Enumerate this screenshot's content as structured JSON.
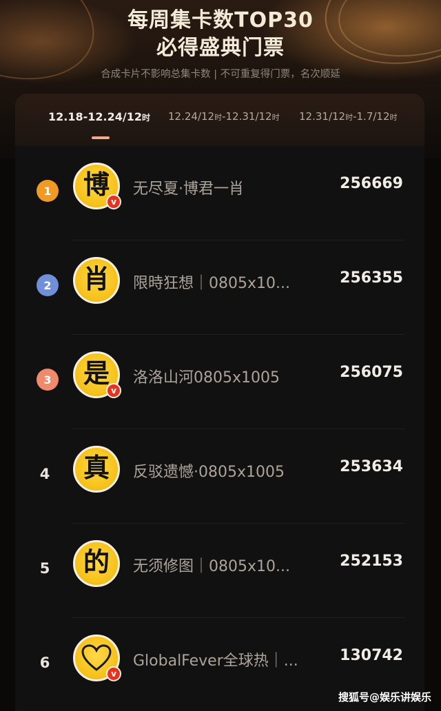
{
  "header": {
    "title_line1": "每周集卡数TOP30",
    "title_line2": "必得盛典门票",
    "subtitle": "合成卡片不影响总集卡数 | 不可重复得门票，名次顺延"
  },
  "tabs": [
    {
      "start": "12.18-12.24/12",
      "unit": "时",
      "active": true
    },
    {
      "start": "12.24/12",
      "unit1": "时",
      "end": "-12.31/12",
      "unit2": "时",
      "active": false
    },
    {
      "start": "12.31/12",
      "unit1": "时",
      "end": "-1.7/12",
      "unit2": "时",
      "active": false
    }
  ],
  "ranking": [
    {
      "rank": "1",
      "avatar_char": "博",
      "verified": "v",
      "name": "无尽夏·博君一肖",
      "count": "256669"
    },
    {
      "rank": "2",
      "avatar_char": "肖",
      "verified": "",
      "name": "限時狂想｜0805x10...",
      "count": "256355"
    },
    {
      "rank": "3",
      "avatar_char": "是",
      "verified": "v",
      "name": "洛洛山河0805x1005",
      "count": "256075"
    },
    {
      "rank": "4",
      "avatar_char": "真",
      "verified": "",
      "name": "反驳遗憾·0805x1005",
      "count": "253634"
    },
    {
      "rank": "5",
      "avatar_char": "的",
      "verified": "",
      "name": "无须修图｜0805x10...",
      "count": "252153"
    },
    {
      "rank": "6",
      "avatar_char": "",
      "verified": "v",
      "name": "GlobalFever全球热｜...",
      "count": "130742"
    }
  ],
  "rank_badge_colors": {
    "1": "#f09a24",
    "2": "#6f8fd8",
    "3": "#ef8a6c"
  },
  "watermark": "搜狐号@娱乐讲娱乐"
}
